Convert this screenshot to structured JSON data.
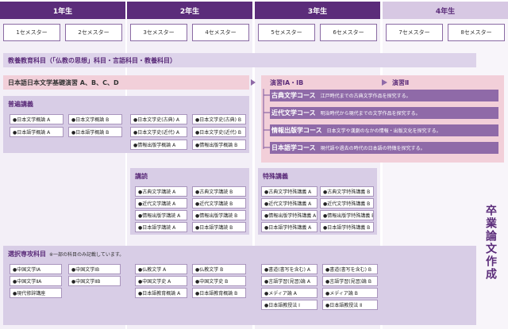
{
  "years": [
    "1年生",
    "2年生",
    "3年生",
    "4年生"
  ],
  "semesters": [
    "1セメスター",
    "2セメスター",
    "3セメスター",
    "4セメスター",
    "5セメスター",
    "6セメスター",
    "7セメスター",
    "8セメスター"
  ],
  "general": "教養教育科目（「仏教の思想」科目・言語科目・教養科目）",
  "seminar_basic": "日本語日本文学基礎演習 A、B、C、D",
  "seminar1": "演習ⅠA・ⅠB",
  "seminar2": "演習Ⅱ",
  "courses": [
    {
      "name": "古典文学コース",
      "desc": "江戸時代までの古典文学作品を探究する。"
    },
    {
      "name": "近代文学コース",
      "desc": "明治時代から現代までの文学作品を探究する。"
    },
    {
      "name": "情報出版学コース",
      "desc": "日本文学や漢劇のなかの情報・出版文化を探究する。"
    },
    {
      "name": "日本語学コース",
      "desc": "現代語や過去の時代の日本語の特徴を探究する。"
    }
  ],
  "fukyu": {
    "title": "普遍講義",
    "y1": [
      [
        "●日本文学概論 A",
        "●日本文学概論 B"
      ],
      [
        "●日本語学概論 A",
        "●日本語学概論 B"
      ]
    ],
    "y2": [
      [
        "●日本文学史(古典) A",
        "●日本文学史(古典) B"
      ],
      [
        "●日本文学史(近代) A",
        "●日本文学史(近代) B"
      ],
      [
        "●情報出版学概論 A",
        "●情報出版学概論 B"
      ]
    ]
  },
  "kodoku": {
    "title": "講読",
    "items": [
      [
        "●古典文学講読 A",
        "●古典文学講読 B"
      ],
      [
        "●近代文学講読 A",
        "●近代文学講読 B"
      ],
      [
        "●情報出版学講読 A",
        "●情報出版学講読 B"
      ],
      [
        "●日本語学講読 A",
        "●日本語学講読 B"
      ]
    ]
  },
  "tokushu": {
    "title": "特殊講義",
    "items": [
      [
        "●古典文学特殊講義 A",
        "●古典文学特殊講義 B"
      ],
      [
        "●近代文学特殊講義 A",
        "●近代文学特殊講義 B"
      ],
      [
        "●情報出版学特殊講義 A",
        "●情報出版学特殊講義 B"
      ],
      [
        "●日本語学特殊講義 A",
        "●日本語学特殊講義 B"
      ]
    ]
  },
  "elective": {
    "title": "選択専攻科目",
    "note": "※一部の科目のみ記載しています。",
    "y1": [
      [
        "●中国文学ⅠA",
        "●中国文学ⅠB"
      ],
      [
        "●中国文学ⅡA",
        "●中国文学ⅡB"
      ],
      [
        "●現代修辞講座",
        ""
      ]
    ],
    "y2": [
      [
        "●仏教文学 A",
        "●仏教文学 B"
      ],
      [
        "●中国文学史 A",
        "●中国文学史 B"
      ],
      [
        "●日本語教育概論 A",
        "●日本語教育概論 B"
      ]
    ],
    "y3": [
      [
        "●書道(書写を含む) A",
        "●書道(書写を含む) B"
      ],
      [
        "●言語学習(見習)論 A",
        "●言語学習(見習)論 B"
      ],
      [
        "●メディア論 A",
        "●メディア論 B"
      ],
      [
        "●日本語教授法 Ⅰ",
        "●日本語教授法 Ⅱ"
      ]
    ]
  },
  "thesis": "卒業論文作成"
}
